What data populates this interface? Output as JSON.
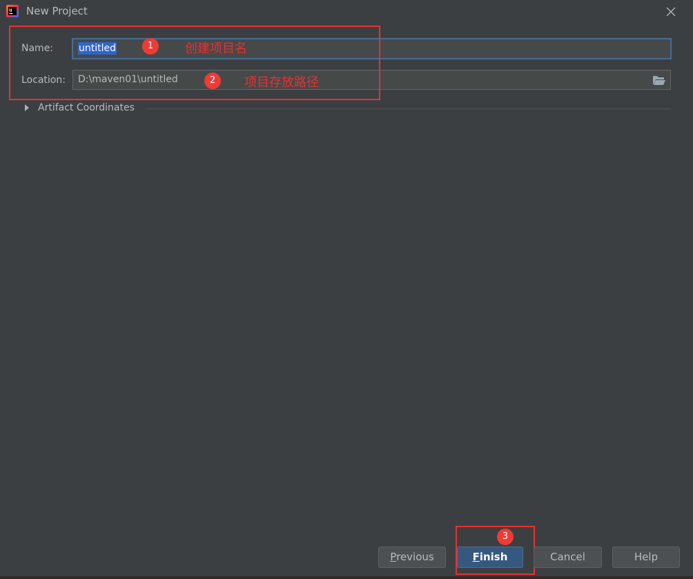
{
  "window": {
    "title": "New Project",
    "app_icon": "intellij-idea-icon",
    "close_icon": "close-icon"
  },
  "form": {
    "name_label": "Name:",
    "name_value": "untitled",
    "location_label": "Location:",
    "location_value": "D:\\maven01\\untitled",
    "browse_icon": "folder-open-icon"
  },
  "artifact": {
    "label": "Artifact Coordinates",
    "expanded": false
  },
  "annotations": {
    "badge1": "1",
    "text1": "创建项目名",
    "badge2": "2",
    "text2": "项目存放路径",
    "badge3": "3",
    "color": "#e8312f"
  },
  "buttons": {
    "previous": {
      "mnemonic": "P",
      "rest": "revious"
    },
    "finish": {
      "mnemonic": "F",
      "rest": "inish"
    },
    "cancel": "Cancel",
    "help": "Help"
  },
  "colors": {
    "background": "#3c3f41",
    "accent": "#365880",
    "selection": "#2f65ca"
  }
}
